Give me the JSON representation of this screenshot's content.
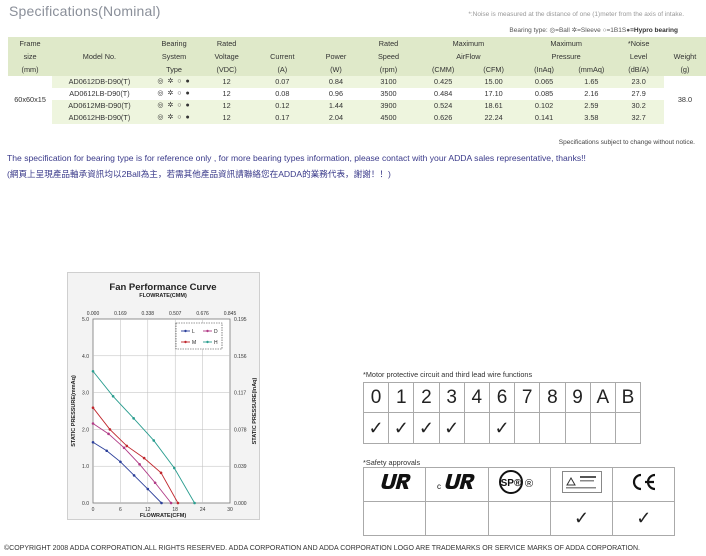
{
  "title": "Specifications(Nominal)",
  "noise_note": "*:Noise is measured at the distance of one (1)meter from the axis of intake.",
  "bearing_legend": {
    "prefix": "Bearing type:",
    "ball": "=Ball",
    "sleeve": "=Sleeve",
    "onebs": "=1B1S",
    "hypro": "=Hypro bearing"
  },
  "table": {
    "headers": {
      "frame": [
        "Frame",
        "size",
        "(mm)"
      ],
      "model": "Model No.",
      "bearing": [
        "Bearing",
        "System",
        "Type"
      ],
      "voltage": [
        "Rated",
        "Voltage",
        "(VDC)"
      ],
      "current": [
        "Current",
        "(A)"
      ],
      "power": [
        "Power",
        "(W)"
      ],
      "speed": [
        "Rated",
        "Speed",
        "(rpm)"
      ],
      "airflow": [
        "Maximum",
        "AirFlow",
        "(CMM)",
        "(CFM)"
      ],
      "pressure": [
        "Maximum",
        "Pressure",
        "(InAq)",
        "(mmAq)"
      ],
      "noise": [
        "*Noise",
        "Level",
        "(dB/A)"
      ],
      "weight": [
        "Weight",
        "(g)"
      ]
    },
    "frame_size": "60x60x15",
    "weight": "38.0",
    "bearing_symbols": "◎ ✲ ○ ●",
    "rows": [
      {
        "model": "AD0612DB-D90(T)",
        "voltage": "12",
        "current": "0.07",
        "power": "0.84",
        "speed": "3100",
        "cmm": "0.425",
        "cfm": "15.00",
        "inaq": "0.065",
        "mmaq": "1.65",
        "noise": "23.0"
      },
      {
        "model": "AD0612LB-D90(T)",
        "voltage": "12",
        "current": "0.08",
        "power": "0.96",
        "speed": "3500",
        "cmm": "0.484",
        "cfm": "17.10",
        "inaq": "0.085",
        "mmaq": "2.16",
        "noise": "27.9"
      },
      {
        "model": "AD0612MB-D90(T)",
        "voltage": "12",
        "current": "0.12",
        "power": "1.44",
        "speed": "3900",
        "cmm": "0.524",
        "cfm": "18.61",
        "inaq": "0.102",
        "mmaq": "2.59",
        "noise": "30.2"
      },
      {
        "model": "AD0612HB-D90(T)",
        "voltage": "12",
        "current": "0.17",
        "power": "2.04",
        "speed": "4500",
        "cmm": "0.626",
        "cfm": "22.24",
        "inaq": "0.141",
        "mmaq": "3.58",
        "noise": "32.7"
      }
    ]
  },
  "subject_note": "Specifications subject to change without notice.",
  "disclaimer_en": "The specification for bearing type is for reference only , for more bearing types information, please contact with your ADDA sales representative, thanks!!",
  "disclaimer_zh": "(網頁上呈現產品軸承資訊均以2Ball為主，若需其他產品資訊請聯絡您在ADDA的業務代表，謝謝！！)",
  "chart_data": {
    "type": "line",
    "title": "Fan Performance Curve",
    "top_axis_label": "FLOWRATE(CMM)",
    "top_ticks": [
      "0.000",
      "0.169",
      "0.338",
      "0.507",
      "0.676",
      "0.845"
    ],
    "xlabel": "FLOWRATE(CFM)",
    "x_ticks": [
      "0",
      "6",
      "12",
      "18",
      "24",
      "30"
    ],
    "xlim": [
      0,
      30
    ],
    "ylabel": "STATIC PRESSURE(mmAq)",
    "y_ticks": [
      "0.0",
      "1.0",
      "2.0",
      "3.0",
      "4.0",
      "5.0"
    ],
    "ylim": [
      0,
      5
    ],
    "right_label": "STATIC PRESSURE(InAq)",
    "right_ticks": [
      "0.000",
      "0.039",
      "0.078",
      "0.117",
      "0.156",
      "0.195"
    ],
    "grid": true,
    "legend_position": "top-right",
    "series": [
      {
        "name": "L",
        "color": "#2b3f9a",
        "x": [
          0,
          3,
          6,
          9,
          12,
          15
        ],
        "y": [
          1.65,
          1.42,
          1.12,
          0.75,
          0.38,
          0.0
        ]
      },
      {
        "name": "D",
        "color": "#b03a86",
        "x": [
          0,
          3.4,
          6.8,
          10.2,
          13.6,
          17.1
        ],
        "y": [
          2.16,
          1.88,
          1.5,
          1.05,
          0.55,
          0.0
        ]
      },
      {
        "name": "M",
        "color": "#c0272d",
        "x": [
          0,
          3.7,
          7.4,
          11.2,
          14.9,
          18.6
        ],
        "y": [
          2.59,
          2.0,
          1.55,
          1.22,
          0.82,
          0.0
        ]
      },
      {
        "name": "H",
        "color": "#2a9d8f",
        "x": [
          0,
          4.4,
          8.9,
          13.3,
          17.8,
          22.24
        ],
        "y": [
          3.58,
          2.9,
          2.3,
          1.7,
          0.95,
          0.0
        ]
      }
    ]
  },
  "motor": {
    "label": "*Motor protective circuit and third lead wire functions",
    "codes": [
      "0",
      "1",
      "2",
      "3",
      "4",
      "6",
      "7",
      "8",
      "9",
      "A",
      "B"
    ],
    "checks": [
      "✓",
      "✓",
      "✓",
      "✓",
      "",
      "✓",
      "",
      "",
      "",
      "",
      ""
    ]
  },
  "safety": {
    "label": "*Safety approvals",
    "logos": [
      "UR",
      "cUR",
      "CSA",
      "TUV",
      "CE"
    ],
    "csa_text": "SP®",
    "checks": [
      "",
      "",
      "",
      "✓",
      "✓"
    ]
  },
  "copyright": "©COPYRIGHT 2008 ADDA CORPORATION.ALL RIGHTS RESERVED. ADDA CORPORATION AND ADDA  CORPORATION LOGO ARE TRADEMARKS OR SERVICE MARKS OF ADDA CORPORATION."
}
